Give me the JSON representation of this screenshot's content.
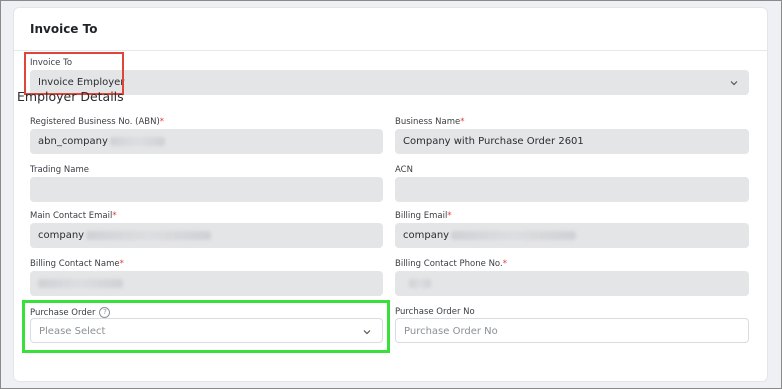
{
  "card": {
    "title": "Invoice To"
  },
  "invoice_to": {
    "label": "Invoice To",
    "value": "Invoice Employer"
  },
  "employer_details": {
    "title": "Employer Details"
  },
  "fields": {
    "abn": {
      "label": "Registered Business No. (ABN)",
      "value": "abn_company"
    },
    "business_name": {
      "label": "Business Name",
      "value": "Company with Purchase Order 2601"
    },
    "trading_name": {
      "label": "Trading Name",
      "value": ""
    },
    "acn": {
      "label": "ACN",
      "value": ""
    },
    "main_contact_email": {
      "label": "Main Contact Email",
      "value": "company"
    },
    "billing_email": {
      "label": "Billing Email",
      "value": "company"
    },
    "billing_contact_name": {
      "label": "Billing Contact Name",
      "value": ""
    },
    "billing_contact_phone": {
      "label": "Billing Contact Phone No.",
      "value": ""
    },
    "purchase_order": {
      "label": "Purchase Order",
      "placeholder": "Please Select"
    },
    "purchase_order_no": {
      "label": "Purchase Order No",
      "placeholder": "Purchase Order No"
    }
  },
  "required_marker": "*",
  "help_glyph": "?",
  "icons": {
    "chevron": "chevron-down-icon",
    "help": "help-circle-icon"
  },
  "colors": {
    "highlight_red": "#e0453a",
    "highlight_green": "#39e039",
    "required": "#e23b3b"
  }
}
